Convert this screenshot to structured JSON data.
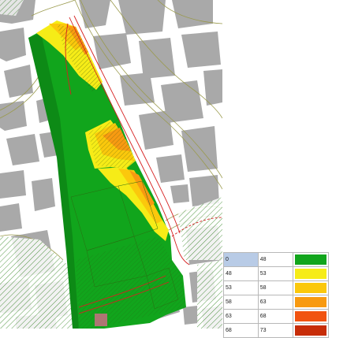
{
  "legend": {
    "rows": [
      {
        "from": "0",
        "to": "48",
        "color": "#11a51c"
      },
      {
        "from": "48",
        "to": "53",
        "color": "#f6ec17"
      },
      {
        "from": "53",
        "to": "58",
        "color": "#fbc80c"
      },
      {
        "from": "58",
        "to": "63",
        "color": "#f89a11"
      },
      {
        "from": "63",
        "to": "68",
        "color": "#f15310"
      },
      {
        "from": "68",
        "to": "73",
        "color": "#c72d08"
      }
    ]
  },
  "map": {
    "building_color": "#a9a9a9",
    "road_line_color": "#9a9a4c",
    "hatch_color": "#3a8a2a",
    "red_line_color": "#d62020"
  }
}
